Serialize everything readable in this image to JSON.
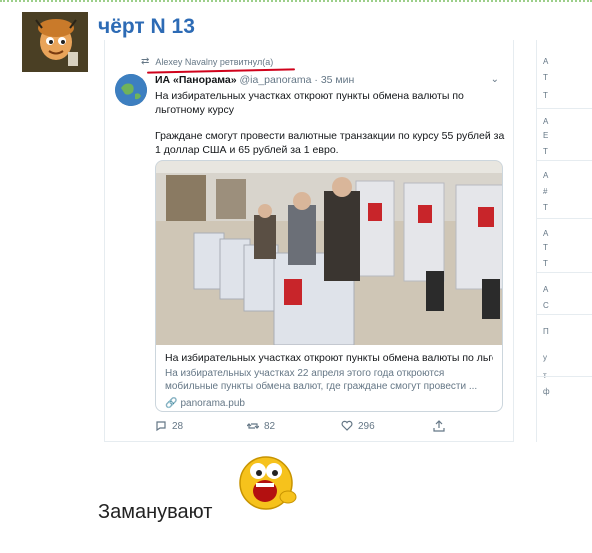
{
  "post": {
    "username": "чёрт N 13",
    "caption": "Заманувают"
  },
  "tweet": {
    "retweet_label": "Alexey Navalny ретвитнул(а)",
    "author_name": "ИА «Панорама»",
    "author_handle": "@ia_panorama",
    "separator": " · ",
    "time": "35 мин",
    "text_1": "На избирательных участках откроют пункты обмена валюты по льготному курсу",
    "text_2": "Граждане смогут провести валютные транзакции по курсу 55 рублей за 1 доллар США и 65 рублей за 1 евро.",
    "card": {
      "title": "На избирательных участках откроют пункты обмена валюты по льго...",
      "description": "На избирательных участках 22 апреля этого года откроются мобильные пункты обмена валют, где граждане смогут провести ...",
      "domain": "panorama.pub"
    },
    "actions": {
      "replies": "28",
      "retweets": "82",
      "likes": "296"
    }
  },
  "sidebar_fragments": [
    "А",
    "Т",
    "Т",
    "А",
    "Е",
    "Т",
    "А",
    "#",
    "Т",
    "А",
    "Т",
    "Т",
    "А",
    "С",
    "П",
    "у",
    "т",
    "ф"
  ],
  "colors": {
    "username": "#2d6bb5",
    "retweet_underline": "#d0021b",
    "muted": "#657786",
    "border": "#ccd6dd"
  },
  "icons": [
    "retweet-icon",
    "reply-icon",
    "like-icon",
    "share-icon",
    "link-icon",
    "chevron-down-icon"
  ]
}
